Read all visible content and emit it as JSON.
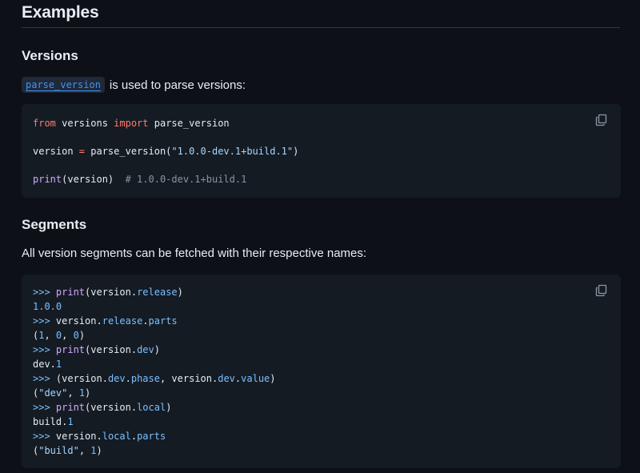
{
  "headings": {
    "examples": "Examples",
    "versions": "Versions",
    "segments": "Segments"
  },
  "versions_para": {
    "code_link": "parse_version",
    "text": "is used to parse versions:"
  },
  "segments_para": "All version segments can be fetched with their respective names:",
  "block1": {
    "l1_kw1": "from",
    "l1_mod": " versions ",
    "l1_kw2": "import",
    "l1_name": " parse_version",
    "l2_lhs": "version ",
    "l2_op": "=",
    "l2_call": " parse_version(",
    "l2_str": "\"1.0.0-dev.1+build.1\"",
    "l2_close": ")",
    "l3_fn": "print",
    "l3_args": "(version)  ",
    "l3_comment": "# 1.0.0-dev.1+build.1"
  },
  "block2": {
    "prompt": ">>>",
    "l1_fn": " print",
    "l1_a": "(version.",
    "l1_p": "release",
    "l1_b": ")",
    "l2": "1.0.0",
    "l3_a": " version.",
    "l3_p1": "release",
    "l3_dot": ".",
    "l3_p2": "parts",
    "l4_a": "(",
    "l4_n1": "1",
    "l4_b": ", ",
    "l4_n2": "0",
    "l4_c": ", ",
    "l4_n3": "0",
    "l4_d": ")",
    "l5_a": "(version.",
    "l5_p": "dev",
    "l5_b": ")",
    "l6_a": "dev.",
    "l6_n": "1",
    "l7_a": " (version.",
    "l7_p1": "dev",
    "l7_dot1": ".",
    "l7_p2": "phase",
    "l7_b": ", version.",
    "l7_p3": "dev",
    "l7_dot2": ".",
    "l7_p4": "value",
    "l7_c": ")",
    "l8_a": "(",
    "l8_s": "\"dev\"",
    "l8_b": ", ",
    "l8_n": "1",
    "l8_c": ")",
    "l9_a": "(version.",
    "l9_p": "local",
    "l9_b": ")",
    "l10_a": "build.",
    "l10_n": "1",
    "l11_a": " version.",
    "l11_p1": "local",
    "l11_dot": ".",
    "l11_p2": "parts",
    "l12_a": "(",
    "l12_s": "\"build\"",
    "l12_b": ", ",
    "l12_n": "1",
    "l12_c": ")"
  },
  "icons": {
    "copy": "copy-icon"
  },
  "colors": {
    "background": "#0d1117",
    "code_bg": "#151b23",
    "keyword": "#ff7b72",
    "string": "#a5d6ff",
    "property": "#79c0ff",
    "function": "#d2a8ff",
    "comment": "#8b949e",
    "link": "#4493f8"
  }
}
